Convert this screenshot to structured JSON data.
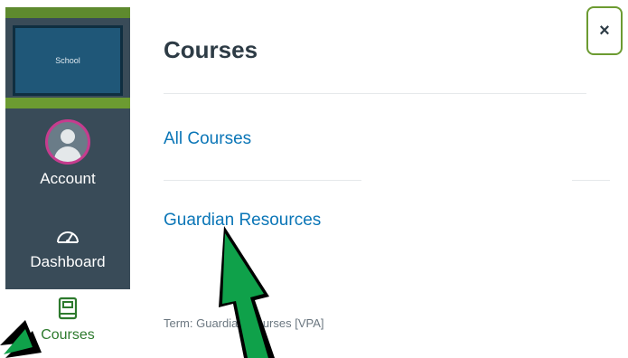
{
  "global_nav": {
    "logo_text": "School",
    "items": [
      {
        "label": "Account",
        "icon": "user-avatar-icon"
      },
      {
        "label": "Dashboard",
        "icon": "speedometer-icon"
      },
      {
        "label": "Courses",
        "icon": "book-icon"
      }
    ],
    "colors": {
      "background": "#394b58",
      "accent_green": "#6c9b31",
      "avatar_ring": "#c63c8e"
    }
  },
  "tray": {
    "title": "Courses",
    "links": [
      "All Courses",
      "Guardian Resources"
    ],
    "term_text": "Term: Guardian Courses [VPA]",
    "close_label": "×"
  },
  "annotations": {
    "arrow_color": "#0fa14a",
    "arrow_icon": "green-arrow-icon"
  }
}
